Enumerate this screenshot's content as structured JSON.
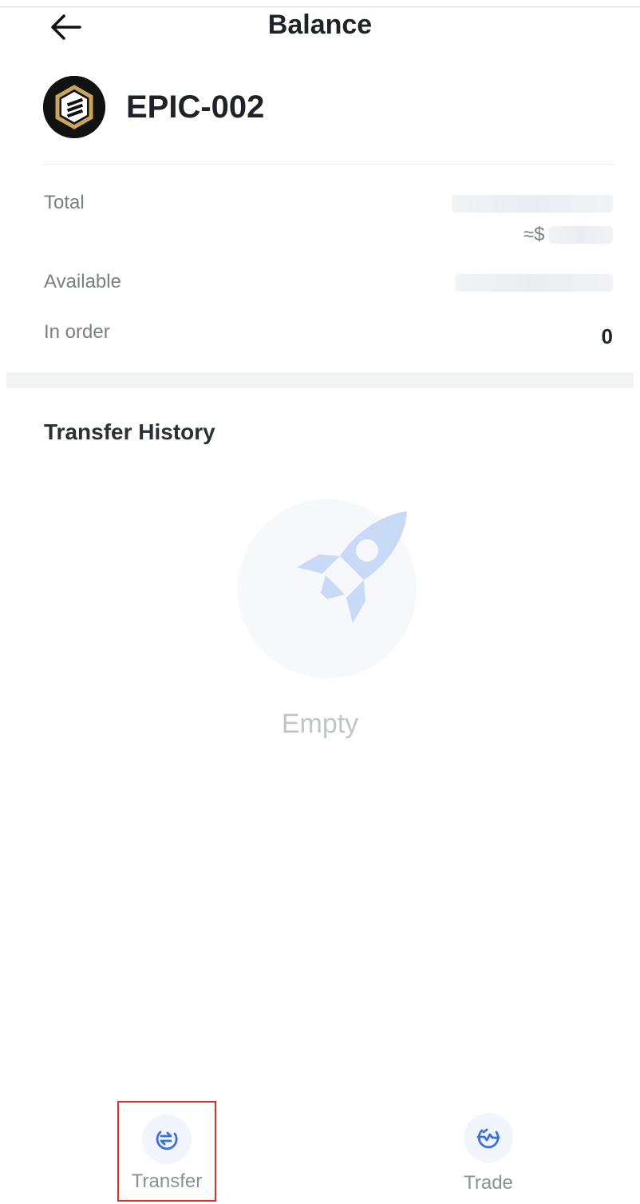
{
  "header": {
    "title": "Balance",
    "back_icon": "arrow-left-icon"
  },
  "coin": {
    "name": "EPIC-002",
    "logo_icon": "epic-coin-logo"
  },
  "balance": {
    "total_label": "Total",
    "usd_prefix": "≈$",
    "available_label": "Available",
    "in_order_label": "In order",
    "in_order_value": "0"
  },
  "transfer_history": {
    "title": "Transfer History",
    "empty_text": "Empty",
    "empty_icon": "rocket-icon"
  },
  "bottom_tabs": [
    {
      "label": "Transfer",
      "icon": "transfer-icon"
    },
    {
      "label": "Trade",
      "icon": "trade-icon"
    }
  ],
  "colors": {
    "accent": "#3b6fe0",
    "highlight_border": "#d9302c",
    "coin_gold": "#c9a45c"
  }
}
